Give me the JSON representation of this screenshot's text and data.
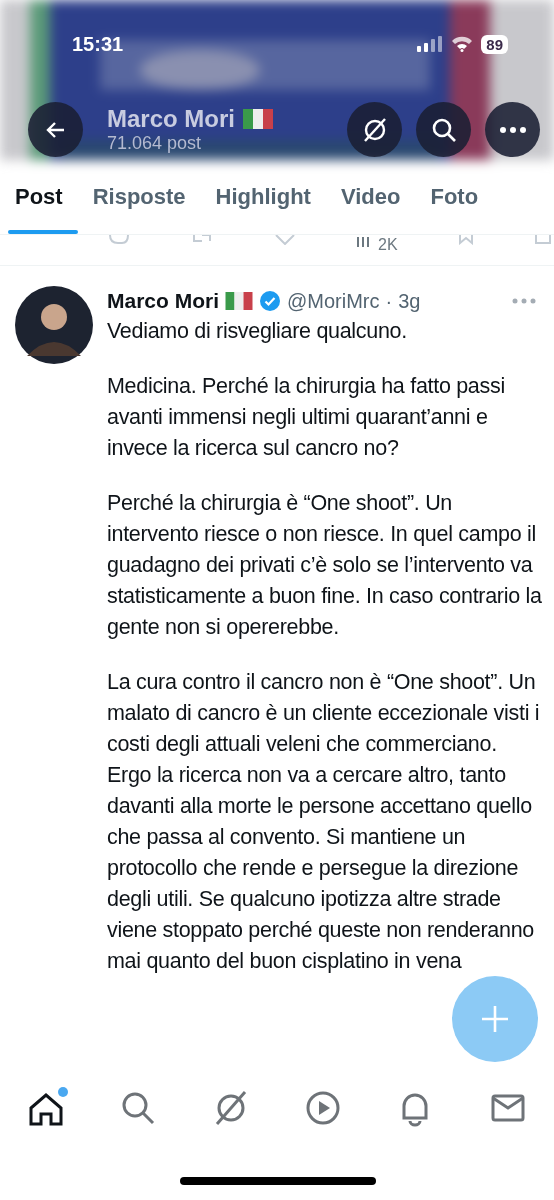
{
  "status_bar": {
    "time": "15:31",
    "battery": "89"
  },
  "header": {
    "name": "Marco Mori",
    "posts": "71.064 post"
  },
  "tabs": [
    {
      "label": "Post",
      "selected": true
    },
    {
      "label": "Risposte",
      "selected": false
    },
    {
      "label": "Highlight",
      "selected": false
    },
    {
      "label": "Video",
      "selected": false
    },
    {
      "label": "Foto",
      "selected": false
    }
  ],
  "previous_post": {
    "views": "2K"
  },
  "post": {
    "name": "Marco Mori",
    "verified": true,
    "handle": "@MoriMrc",
    "separator": "·",
    "time": "3g",
    "paragraphs": [
      "Vediamo di risvegliare qualcuno.",
      "Medicina. Perché la chirurgia ha fatto passi avanti immensi negli ultimi quarant’anni e invece la ricerca sul cancro no?",
      "Perché la chirurgia è “One shoot”. Un intervento riesce o non riesce. In quel campo il guadagno dei privati c’è solo se l’intervento va statisticamente a buon fine. In caso contrario la gente non si opererebbe.",
      "La cura contro il cancro non è “One shoot”. Un malato di cancro è un cliente eccezionale visti i costi degli attuali veleni che commerciano. Ergo la ricerca non va a cercare altro, tanto davanti alla morte le persone accettano quello che passa al convento. Si mantiene un protocollo che rende e persegue la direzione degli utili. Se qualcuno ipotizza altre strade viene stoppato perché queste non renderanno mai quanto del buon cisplatino in vena"
    ]
  },
  "bottom_nav": [
    {
      "kind": "home",
      "selected": true,
      "unread": true
    },
    {
      "kind": "search",
      "selected": false,
      "unread": false
    },
    {
      "kind": "grok",
      "selected": false,
      "unread": false
    },
    {
      "kind": "video",
      "selected": false,
      "unread": false
    },
    {
      "kind": "notifications",
      "selected": false,
      "unread": false
    },
    {
      "kind": "messages",
      "selected": false,
      "unread": false
    }
  ]
}
